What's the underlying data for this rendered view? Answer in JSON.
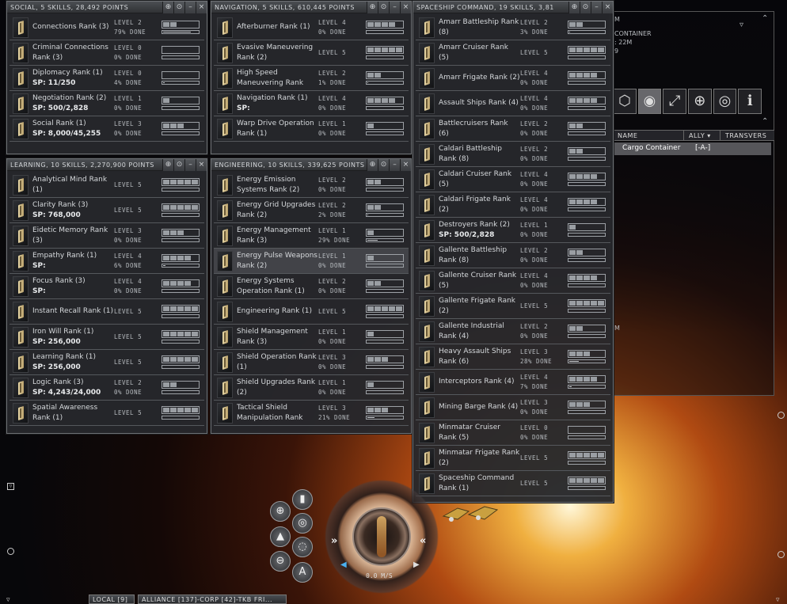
{
  "windows": {
    "social": {
      "title": "SOCIAL, 5 SKILLS, 28,492 POINTS",
      "skills": [
        {
          "name": "Connections Rank (3)",
          "sub": "",
          "level": "LEVEL 2",
          "done": "79% DONE",
          "lvl": 2,
          "progress": 0.79,
          "sel": false
        },
        {
          "name": "Criminal Connections Rank (3)",
          "sub": "",
          "level": "LEVEL 0",
          "done": "0% DONE",
          "lvl": 0,
          "progress": 0,
          "sel": false
        },
        {
          "name": "Diplomacy Rank (1)",
          "sub": "SP: 11/250",
          "level": "LEVEL 0",
          "done": "4% DONE",
          "lvl": 0,
          "progress": 0.04,
          "sel": false
        },
        {
          "name": "Negotiation Rank (2)",
          "sub": "SP: 500/2,828",
          "level": "LEVEL 1",
          "done": "0% DONE",
          "lvl": 1,
          "progress": 0,
          "sel": false
        },
        {
          "name": "Social Rank (1)",
          "sub": "SP: 8,000/45,255",
          "level": "LEVEL 3",
          "done": "0% DONE",
          "lvl": 3,
          "progress": 0,
          "sel": false
        }
      ]
    },
    "navigation": {
      "title": "NAVIGATION, 5 SKILLS, 610,445 POINTS",
      "skills": [
        {
          "name": "Afterburner Rank (1)",
          "sub": "",
          "level": "LEVEL 4",
          "done": "0% DONE",
          "lvl": 4,
          "progress": 0,
          "sel": false
        },
        {
          "name": "Evasive Maneuvering Rank (2)",
          "sub": "",
          "level": "LEVEL 5",
          "done": "",
          "lvl": 5,
          "progress": 0,
          "sel": false
        },
        {
          "name": "High Speed Maneuvering Rank",
          "sub": "",
          "level": "LEVEL 2",
          "done": "1% DONE",
          "lvl": 2,
          "progress": 0.01,
          "sel": false
        },
        {
          "name": "Navigation Rank (1)",
          "sub": "SP:",
          "level": "LEVEL 4",
          "done": "0% DONE",
          "lvl": 4,
          "progress": 0,
          "sel": false
        },
        {
          "name": "Warp Drive Operation Rank (1)",
          "sub": "",
          "level": "LEVEL 1",
          "done": "0% DONE",
          "lvl": 1,
          "progress": 0,
          "sel": false
        }
      ]
    },
    "learning": {
      "title": "LEARNING, 10 SKILLS, 2,270,900 POINTS",
      "skills": [
        {
          "name": "Analytical Mind Rank (1)",
          "sub": "",
          "level": "LEVEL 5",
          "done": "",
          "lvl": 5,
          "progress": 0,
          "sel": false
        },
        {
          "name": "Clarity Rank (3)",
          "sub": "SP: 768,000",
          "level": "LEVEL 5",
          "done": "",
          "lvl": 5,
          "progress": 0,
          "sel": false
        },
        {
          "name": "Eidetic Memory Rank (3)",
          "sub": "",
          "level": "LEVEL 3",
          "done": "0% DONE",
          "lvl": 3,
          "progress": 0,
          "sel": false
        },
        {
          "name": "Empathy Rank (1)",
          "sub": "SP:",
          "level": "LEVEL 4",
          "done": "6% DONE",
          "lvl": 4,
          "progress": 0.06,
          "sel": false
        },
        {
          "name": "Focus Rank (3)",
          "sub": "SP:",
          "level": "LEVEL 4",
          "done": "0% DONE",
          "lvl": 4,
          "progress": 0,
          "sel": false
        },
        {
          "name": "Instant Recall Rank (1)",
          "sub": "",
          "level": "LEVEL 5",
          "done": "",
          "lvl": 5,
          "progress": 0,
          "sel": false
        },
        {
          "name": "Iron Will Rank (1)",
          "sub": "SP: 256,000",
          "level": "LEVEL 5",
          "done": "",
          "lvl": 5,
          "progress": 0,
          "sel": false
        },
        {
          "name": "Learning Rank (1)",
          "sub": "SP: 256,000",
          "level": "LEVEL 5",
          "done": "",
          "lvl": 5,
          "progress": 0,
          "sel": false
        },
        {
          "name": "Logic Rank (3)",
          "sub": "SP: 4,243/24,000",
          "level": "LEVEL 2",
          "done": "0% DONE",
          "lvl": 2,
          "progress": 0,
          "sel": false
        },
        {
          "name": "Spatial Awareness Rank (1)",
          "sub": "",
          "level": "LEVEL 5",
          "done": "",
          "lvl": 5,
          "progress": 0,
          "sel": false
        }
      ]
    },
    "engineering": {
      "title": "ENGINEERING, 10 SKILLS, 339,625 POINTS",
      "skills": [
        {
          "name": "Energy Emission Systems Rank (2)",
          "sub": "",
          "level": "LEVEL 2",
          "done": "0% DONE",
          "lvl": 2,
          "progress": 0,
          "sel": false
        },
        {
          "name": "Energy Grid Upgrades Rank (2)",
          "sub": "",
          "level": "LEVEL 2",
          "done": "2% DONE",
          "lvl": 2,
          "progress": 0.02,
          "sel": false
        },
        {
          "name": "Energy Management Rank (3)",
          "sub": "",
          "level": "LEVEL 1",
          "done": "29% DONE",
          "lvl": 1,
          "progress": 0.29,
          "sel": false
        },
        {
          "name": "Energy Pulse Weapons Rank (2)",
          "sub": "",
          "level": "LEVEL 1",
          "done": "0% DONE",
          "lvl": 1,
          "progress": 0,
          "sel": true
        },
        {
          "name": "Energy Systems Operation Rank (1)",
          "sub": "",
          "level": "LEVEL 2",
          "done": "0% DONE",
          "lvl": 2,
          "progress": 0,
          "sel": false
        },
        {
          "name": "Engineering Rank (1)",
          "sub": "",
          "level": "LEVEL 5",
          "done": "",
          "lvl": 5,
          "progress": 0,
          "sel": false
        },
        {
          "name": "Shield Management Rank (3)",
          "sub": "",
          "level": "LEVEL 1",
          "done": "0% DONE",
          "lvl": 1,
          "progress": 0,
          "sel": false
        },
        {
          "name": "Shield Operation Rank (1)",
          "sub": "",
          "level": "LEVEL 3",
          "done": "0% DONE",
          "lvl": 3,
          "progress": 0,
          "sel": false
        },
        {
          "name": "Shield Upgrades Rank (2)",
          "sub": "",
          "level": "LEVEL 1",
          "done": "0% DONE",
          "lvl": 1,
          "progress": 0,
          "sel": false
        },
        {
          "name": "Tactical Shield Manipulation Rank",
          "sub": "",
          "level": "LEVEL 3",
          "done": "21% DONE",
          "lvl": 3,
          "progress": 0.21,
          "sel": false
        }
      ]
    },
    "spaceship": {
      "title": "SPACESHIP COMMAND, 19 SKILLS, 3,81",
      "skills": [
        {
          "name": "Amarr Battleship Rank (8)",
          "sub": "",
          "level": "LEVEL 2",
          "done": "3% DONE",
          "lvl": 2,
          "progress": 0.03,
          "sel": false
        },
        {
          "name": "Amarr Cruiser Rank (5)",
          "sub": "",
          "level": "LEVEL 5",
          "done": "",
          "lvl": 5,
          "progress": 0,
          "sel": false
        },
        {
          "name": "Amarr Frigate Rank (2)",
          "sub": "",
          "level": "LEVEL 4",
          "done": "0% DONE",
          "lvl": 4,
          "progress": 0,
          "sel": false
        },
        {
          "name": "Assault Ships Rank (4)",
          "sub": "",
          "level": "LEVEL 4",
          "done": "0% DONE",
          "lvl": 4,
          "progress": 0,
          "sel": false
        },
        {
          "name": "Battlecruisers Rank (6)",
          "sub": "",
          "level": "LEVEL 2",
          "done": "0% DONE",
          "lvl": 2,
          "progress": 0,
          "sel": false
        },
        {
          "name": "Caldari Battleship Rank (8)",
          "sub": "",
          "level": "LEVEL 2",
          "done": "0% DONE",
          "lvl": 2,
          "progress": 0,
          "sel": false
        },
        {
          "name": "Caldari Cruiser Rank (5)",
          "sub": "",
          "level": "LEVEL 4",
          "done": "0% DONE",
          "lvl": 4,
          "progress": 0,
          "sel": false
        },
        {
          "name": "Caldari Frigate Rank (2)",
          "sub": "",
          "level": "LEVEL 4",
          "done": "0% DONE",
          "lvl": 4,
          "progress": 0,
          "sel": false
        },
        {
          "name": "Destroyers Rank (2)",
          "sub": "SP: 500/2,828",
          "level": "LEVEL 1",
          "done": "0% DONE",
          "lvl": 1,
          "progress": 0,
          "sel": false
        },
        {
          "name": "Gallente Battleship Rank (8)",
          "sub": "",
          "level": "LEVEL 2",
          "done": "0% DONE",
          "lvl": 2,
          "progress": 0,
          "sel": false
        },
        {
          "name": "Gallente Cruiser Rank (5)",
          "sub": "",
          "level": "LEVEL 4",
          "done": "0% DONE",
          "lvl": 4,
          "progress": 0,
          "sel": false
        },
        {
          "name": "Gallente Frigate Rank (2)",
          "sub": "",
          "level": "LEVEL 5",
          "done": "",
          "lvl": 5,
          "progress": 0,
          "sel": false
        },
        {
          "name": "Gallente Industrial Rank (4)",
          "sub": "",
          "level": "LEVEL 2",
          "done": "0% DONE",
          "lvl": 2,
          "progress": 0,
          "sel": false
        },
        {
          "name": "Heavy Assault Ships Rank (6)",
          "sub": "",
          "level": "LEVEL 3",
          "done": "28% DONE",
          "lvl": 3,
          "progress": 0.28,
          "sel": false
        },
        {
          "name": "Interceptors Rank (4)",
          "sub": "",
          "level": "LEVEL 4",
          "done": "7% DONE",
          "lvl": 4,
          "progress": 0.07,
          "sel": false
        },
        {
          "name": "Mining Barge Rank (4)",
          "sub": "",
          "level": "LEVEL 3",
          "done": "0% DONE",
          "lvl": 3,
          "progress": 0,
          "sel": false
        },
        {
          "name": "Minmatar Cruiser Rank (5)",
          "sub": "",
          "level": "LEVEL 0",
          "done": "0% DONE",
          "lvl": 0,
          "progress": 0,
          "sel": false
        },
        {
          "name": "Minmatar Frigate Rank (2)",
          "sub": "",
          "level": "LEVEL 5",
          "done": "",
          "lvl": 5,
          "progress": 0,
          "sel": false
        },
        {
          "name": "Spaceship Command Rank (1)",
          "sub": "",
          "level": "LEVEL 5",
          "done": "",
          "lvl": 5,
          "progress": 0,
          "sel": false
        }
      ]
    }
  },
  "window_controls": {
    "pin": "⊕",
    "settings": "⊙",
    "minimize": "–",
    "close": "×"
  },
  "overview": {
    "label_m": "M",
    "container_label": "CONTAINER",
    "dist_label": ": 22M",
    "small_val": "9",
    "label_m2": "M",
    "columns": [
      "NAME",
      "ALLY ▾",
      "TRANSVERS"
    ],
    "row": {
      "name": "Cargo Container",
      "ally": "[-A-]"
    },
    "icons": [
      "cube-icon",
      "orbit-icon",
      "approach-icon",
      "target-icon",
      "eye-icon",
      "info-icon"
    ]
  },
  "hud": {
    "speed": "0.0 M/S",
    "btn_a": "A"
  },
  "tabs": {
    "local": "LOCAL [9]",
    "alliance": "ALLIANCE [137]-CORP [42]-TKB FRI..."
  }
}
